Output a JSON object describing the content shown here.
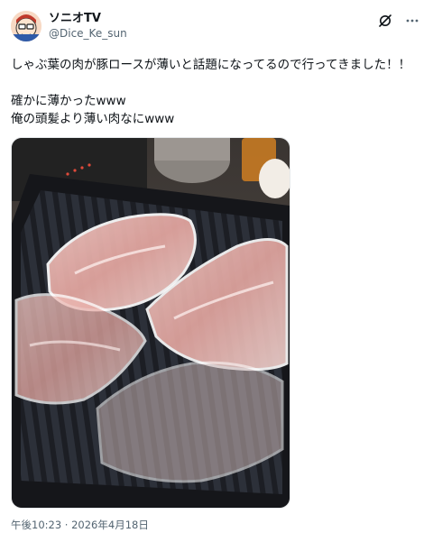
{
  "user": {
    "display_name": "ソニオTV",
    "handle": "@Dice_Ke_sun"
  },
  "header": {
    "grok_icon": "grok-icon",
    "more_icon": "more-dots-icon"
  },
  "tweet": {
    "lines": [
      "しゃぶ葉の肉が豚ロースが薄いと話題になってるので行ってきました！！",
      "",
      "確かに薄かったwww",
      "俺の頭髪より薄い肉なにwww"
    ],
    "timestamp": "午後10:23 · 2026年4月18日"
  },
  "media": {
    "description_icon": "photo-sliced-pork-on-grill"
  },
  "colors": {
    "text": "#0f1419",
    "secondary": "#536471"
  }
}
